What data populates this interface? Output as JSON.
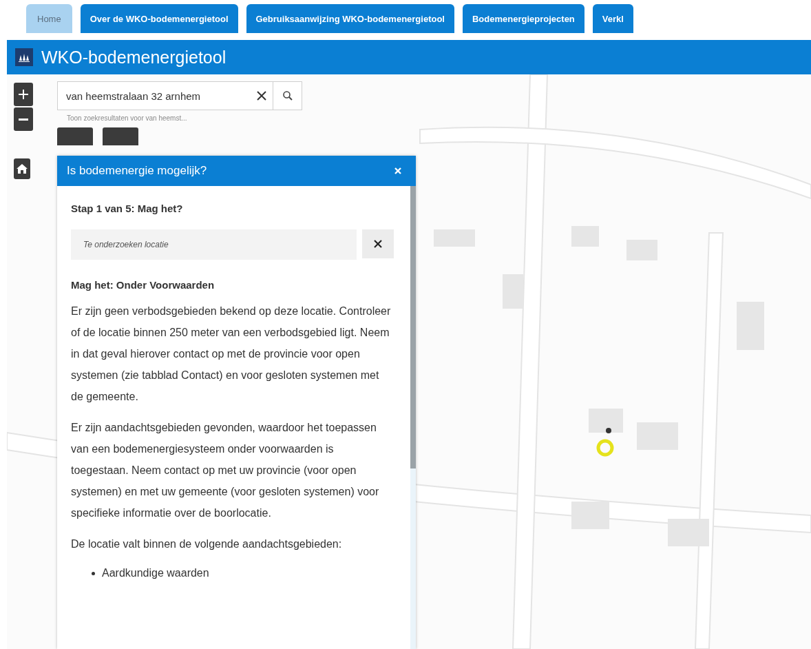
{
  "tabs": [
    {
      "label": "Home",
      "selected": true
    },
    {
      "label": "Over de WKO-bodemenergietool",
      "selected": false
    },
    {
      "label": "Gebruiksaanwijzing WKO-bodemenergietool",
      "selected": false
    },
    {
      "label": "Bodemenergieprojecten",
      "selected": false
    },
    {
      "label": "Verkl",
      "selected": false
    }
  ],
  "header": {
    "title": "WKO-bodemenergietool"
  },
  "search": {
    "value": "van heemstralaan 32 arnhem",
    "hint": "Toon zoekresultaten voor van heemst..."
  },
  "panel": {
    "title": "Is bodemenergie mogelijk?",
    "step": "Stap 1 van 5: Mag het?",
    "location_field": {
      "placeholder": "Te onderzoeken locatie"
    },
    "result_heading": "Mag het: Onder Voorwaarden",
    "paragraphs": [
      "Er zijn geen verbodsgebieden bekend op deze locatie. Controleer of de locatie binnen 250 meter van een verbodsgebied ligt. Neem in dat geval hierover contact op met de provincie voor open systemen (zie tabblad Contact) en voor gesloten systemen met de gemeente.",
      "Er zijn aandachtsgebieden gevonden, waardoor het toepassen van een bodemenergiesysteem onder voorwaarden is toegestaan. Neem contact op met uw provincie (voor open systemen) en met uw gemeente (voor gesloten systemen) voor specifieke informatie over de boorlocatie.",
      "De locatie valt binnen de volgende aandachtsgebieden:"
    ],
    "list": [
      "Aardkundige waarden"
    ]
  }
}
